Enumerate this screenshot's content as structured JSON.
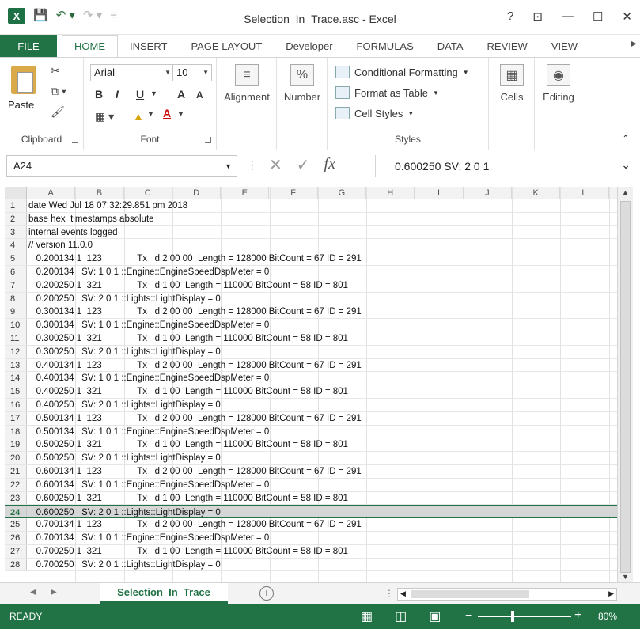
{
  "window": {
    "title": "Selection_In_Trace.asc - Excel",
    "app_icon": "X",
    "help": "?",
    "ribbon_display": "⊡",
    "minimize": "—",
    "maximize": "☐",
    "close": "✕"
  },
  "ribbon_tabs": [
    "FILE",
    "HOME",
    "INSERT",
    "PAGE LAYOUT",
    "Developer",
    "FORMULAS",
    "DATA",
    "REVIEW",
    "VIEW"
  ],
  "ribbon": {
    "clipboard": {
      "label": "Clipboard",
      "paste": "Paste"
    },
    "font": {
      "label": "Font",
      "name": "Arial",
      "size": "10",
      "bold": "B",
      "italic": "I",
      "underline": "U",
      "grow": "A",
      "shrink": "A"
    },
    "alignment": {
      "label": "Alignment"
    },
    "number": {
      "label": "Number",
      "icon_text": "%"
    },
    "styles": {
      "label": "Styles",
      "conditional": "Conditional Formatting",
      "table": "Format as Table",
      "cell_styles": "Cell Styles"
    },
    "cells": {
      "label": "Cells"
    },
    "editing": {
      "label": "Editing"
    }
  },
  "formula_bar": {
    "name_box": "A24",
    "fx": "fx",
    "content": "0.600250   SV: 2 0 1"
  },
  "columns": [
    "A",
    "B",
    "C",
    "D",
    "E",
    "F",
    "G",
    "H",
    "I",
    "J",
    "K",
    "L"
  ],
  "rows": [
    {
      "n": "1",
      "text": "date Wed Jul 18 07:32:29.851 pm 2018"
    },
    {
      "n": "2",
      "text": "base hex  timestamps absolute"
    },
    {
      "n": "3",
      "text": "internal events logged"
    },
    {
      "n": "4",
      "text": "// version 11.0.0"
    },
    {
      "n": "5",
      "text": "   0.200134 1  123              Tx   d 2 00 00  Length = 128000 BitCount = 67 ID = 291"
    },
    {
      "n": "6",
      "text": "   0.200134   SV: 1 0 1 ::Engine::EngineSpeedDspMeter = 0"
    },
    {
      "n": "7",
      "text": "   0.200250 1  321              Tx   d 1 00  Length = 110000 BitCount = 58 ID = 801"
    },
    {
      "n": "8",
      "text": "   0.200250   SV: 2 0 1 ::Lights::LightDisplay = 0"
    },
    {
      "n": "9",
      "text": "   0.300134 1  123              Tx   d 2 00 00  Length = 128000 BitCount = 67 ID = 291"
    },
    {
      "n": "10",
      "text": "   0.300134   SV: 1 0 1 ::Engine::EngineSpeedDspMeter = 0"
    },
    {
      "n": "11",
      "text": "   0.300250 1  321              Tx   d 1 00  Length = 110000 BitCount = 58 ID = 801"
    },
    {
      "n": "12",
      "text": "   0.300250   SV: 2 0 1 ::Lights::LightDisplay = 0"
    },
    {
      "n": "13",
      "text": "   0.400134 1  123              Tx   d 2 00 00  Length = 128000 BitCount = 67 ID = 291"
    },
    {
      "n": "14",
      "text": "   0.400134   SV: 1 0 1 ::Engine::EngineSpeedDspMeter = 0"
    },
    {
      "n": "15",
      "text": "   0.400250 1  321              Tx   d 1 00  Length = 110000 BitCount = 58 ID = 801"
    },
    {
      "n": "16",
      "text": "   0.400250   SV: 2 0 1 ::Lights::LightDisplay = 0"
    },
    {
      "n": "17",
      "text": "   0.500134 1  123              Tx   d 2 00 00  Length = 128000 BitCount = 67 ID = 291"
    },
    {
      "n": "18",
      "text": "   0.500134   SV: 1 0 1 ::Engine::EngineSpeedDspMeter = 0"
    },
    {
      "n": "19",
      "text": "   0.500250 1  321              Tx   d 1 00  Length = 110000 BitCount = 58 ID = 801"
    },
    {
      "n": "20",
      "text": "   0.500250   SV: 2 0 1 ::Lights::LightDisplay = 0"
    },
    {
      "n": "21",
      "text": "   0.600134 1  123              Tx   d 2 00 00  Length = 128000 BitCount = 67 ID = 291"
    },
    {
      "n": "22",
      "text": "   0.600134   SV: 1 0 1 ::Engine::EngineSpeedDspMeter = 0"
    },
    {
      "n": "23",
      "text": "   0.600250 1  321              Tx   d 1 00  Length = 110000 BitCount = 58 ID = 801"
    },
    {
      "n": "24",
      "text": "   0.600250   SV: 2 0 1 ::Lights::LightDisplay = 0",
      "selected": true
    },
    {
      "n": "25",
      "text": "   0.700134 1  123              Tx   d 2 00 00  Length = 128000 BitCount = 67 ID = 291"
    },
    {
      "n": "26",
      "text": "   0.700134   SV: 1 0 1 ::Engine::EngineSpeedDspMeter = 0"
    },
    {
      "n": "27",
      "text": "   0.700250 1  321              Tx   d 1 00  Length = 110000 BitCount = 58 ID = 801"
    },
    {
      "n": "28",
      "text": "   0.700250   SV: 2 0 1 ::Lights::LightDisplay = 0"
    }
  ],
  "sheet": {
    "tab": "Selection_In_Trace",
    "add": "+"
  },
  "status": {
    "text": "READY",
    "zoom": "80%",
    "minus": "−",
    "plus": "+"
  }
}
